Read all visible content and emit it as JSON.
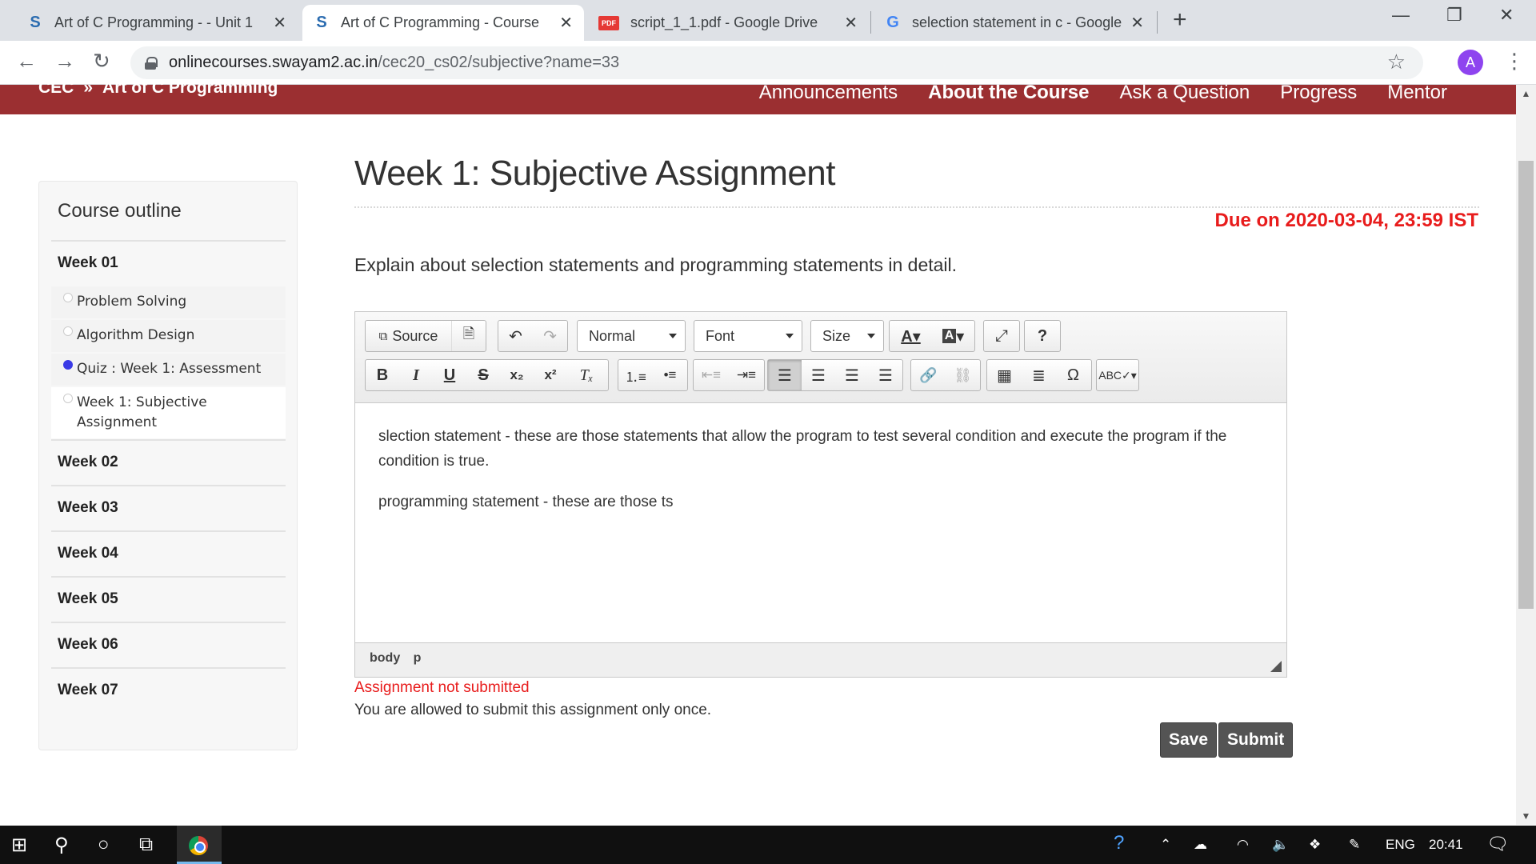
{
  "browser": {
    "tabs": [
      {
        "title": "Art of C Programming - - Unit 1",
        "icon": "swayam-icon"
      },
      {
        "title": "Art of C Programming - Course",
        "icon": "swayam-icon"
      },
      {
        "title": "script_1_1.pdf - Google Drive",
        "icon": "pdf-icon",
        "badge": "PDF"
      },
      {
        "title": "selection statement in c - Google",
        "icon": "google-icon"
      }
    ],
    "url_host": "onlinecourses.swayam2.ac.in",
    "url_path": "/cec20_cs02/subjective?name=33",
    "profile_initial": "A",
    "tab_favicon_letter": "S",
    "google_letter": "G"
  },
  "header": {
    "brand_org": "CEC",
    "brand_sep": "»",
    "brand_course": "Art of C Programming",
    "nav": [
      "Announcements",
      "About the Course",
      "Ask a Question",
      "Progress",
      "Mentor"
    ],
    "accent": "#9b2f31"
  },
  "sidebar": {
    "title": "Course outline",
    "weeks": [
      "Week 01",
      "Week 02",
      "Week 03",
      "Week 04",
      "Week 05",
      "Week 06",
      "Week 07"
    ],
    "units": [
      "Problem Solving",
      "Algorithm Design",
      "Quiz : Week 1: Assessment",
      "Week 1: Subjective Assignment"
    ]
  },
  "main": {
    "title": "Week 1: Subjective Assignment",
    "due": "Due on 2020-03-04, 23:59 IST",
    "question": "Explain about selection statements and programming statements in detail.",
    "editor": {
      "source_label": "Source",
      "format_value": "Normal",
      "font_value": "Font",
      "size_value": "Size",
      "paragraphs": [
        "slection statement - these are those statements that allow the program to test several condition and execute the program if the condition is true.",
        "programming statement - these are those ts"
      ],
      "path": [
        "body",
        "p"
      ]
    },
    "status": "Assignment not submitted",
    "note": "You are allowed to submit this assignment only once.",
    "save_label": "Save",
    "submit_label": "Submit"
  },
  "taskbar": {
    "lang": "ENG",
    "time": "20:41"
  }
}
